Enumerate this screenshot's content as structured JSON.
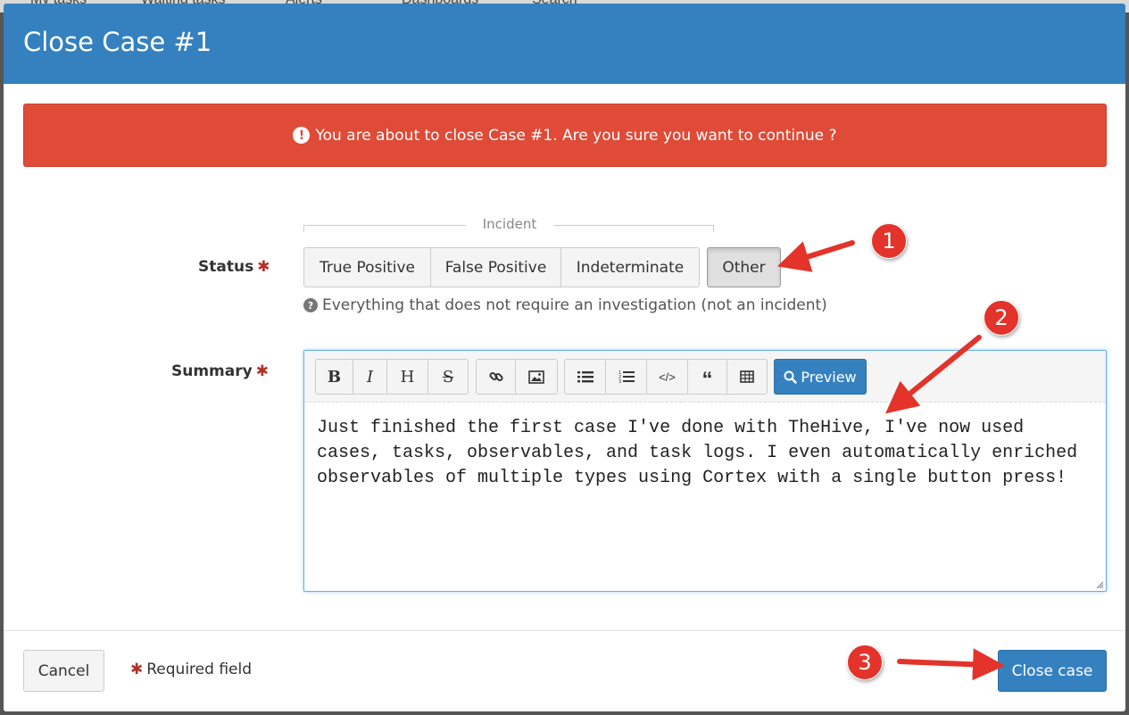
{
  "background_nav": {
    "items": [
      "My tasks",
      "Waiting tasks",
      "Alerts",
      "Dashboards",
      "Search"
    ]
  },
  "modal": {
    "title": "Close Case #1",
    "alert": {
      "icon": "exclamation-circle-icon",
      "text": "You are about to close Case #1. Are you sure you want to continue ?"
    },
    "status": {
      "label": "Status",
      "group_label": "Incident",
      "options": [
        "True Positive",
        "False Positive",
        "Indeterminate",
        "Other"
      ],
      "selected": "Other",
      "help": "Everything that does not require an investigation (not an incident)"
    },
    "summary": {
      "label": "Summary",
      "preview_label": "Preview",
      "toolbar": [
        "bold",
        "italic",
        "heading",
        "strikethrough",
        "link",
        "image",
        "unordered-list",
        "ordered-list",
        "code",
        "quote",
        "table"
      ],
      "value": "Just finished the first case I've done with TheHive, I've now used\ncases, tasks, observables, and task logs. I even automatically enriched\nobservables of multiple types using Cortex with a single button press!"
    },
    "footer": {
      "cancel_label": "Cancel",
      "required_note": "Required field",
      "close_label": "Close case"
    }
  },
  "annotations": {
    "badges": [
      "1",
      "2",
      "3"
    ]
  },
  "colors": {
    "primary": "#3581c0",
    "danger": "#df4b37",
    "badge": "#e3332a",
    "required": "#b0322a"
  }
}
